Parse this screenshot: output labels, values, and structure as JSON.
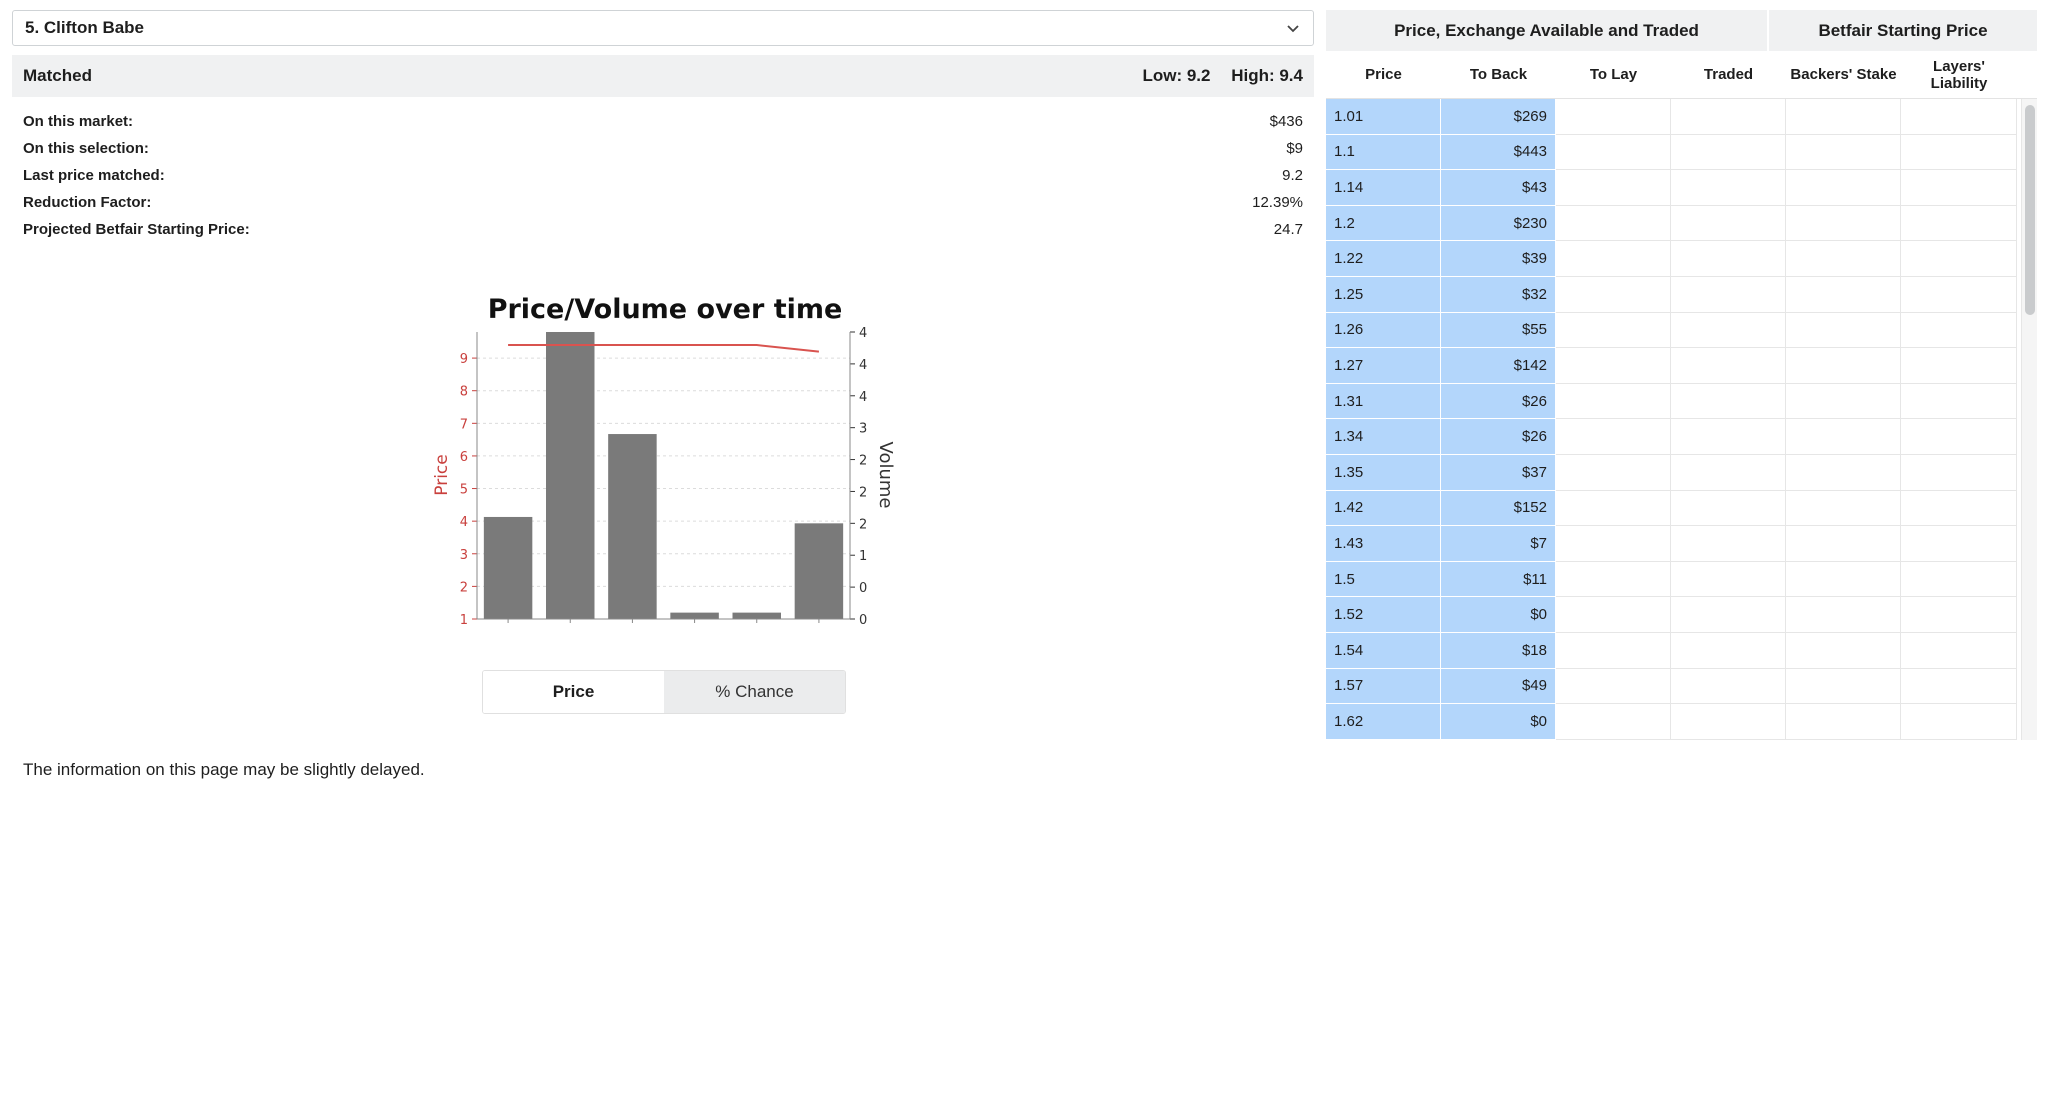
{
  "selection": {
    "label": "5. Clifton Babe",
    "icon": "chevron-down-icon"
  },
  "matched": {
    "title": "Matched",
    "low": "Low: 9.2",
    "high": "High: 9.4"
  },
  "stats": [
    {
      "label": "On this market:",
      "value": "$436"
    },
    {
      "label": "On this selection:",
      "value": "$9"
    },
    {
      "label": "Last price matched:",
      "value": "9.2"
    },
    {
      "label": "Reduction Factor:",
      "value": "12.39%"
    },
    {
      "label": "Projected Betfair Starting Price:",
      "value": "24.7"
    }
  ],
  "toggle": {
    "price": "Price",
    "chance": "% Chance"
  },
  "delay_note": "The information on this page may be slightly delayed.",
  "chart_data": {
    "type": "bar",
    "title": "Price/Volume over time",
    "ylabel": "Price",
    "y2label": "Volume",
    "ylim": [
      1,
      9.8
    ],
    "y2lim": [
      0,
      4.5
    ],
    "y_ticks": [
      "1",
      "2",
      "3",
      "4",
      "5",
      "6",
      "7",
      "8",
      "9"
    ],
    "y2_ticks": [
      "0",
      "0",
      "1",
      "2",
      "2",
      "2",
      "3",
      "4",
      "4",
      "4"
    ],
    "volume_values": [
      1.6,
      4.5,
      2.9,
      0.1,
      0.1,
      1.5
    ],
    "price_line": [
      9.4,
      9.4,
      9.4,
      9.4,
      9.4,
      9.2
    ],
    "colors": {
      "bars": "#7a7a7a",
      "price_line": "#d9534f",
      "price_axis": "#c9403d"
    },
    "grid": true
  },
  "ladder": {
    "group_headers": [
      "Price, Exchange Available and Traded",
      "Betfair Starting Price"
    ],
    "columns": [
      "Price",
      "To Back",
      "To Lay",
      "Traded",
      "Backers' Stake",
      "Layers' Liability"
    ],
    "rows": [
      {
        "price": "1.01",
        "back": "$269"
      },
      {
        "price": "1.1",
        "back": "$443"
      },
      {
        "price": "1.14",
        "back": "$43"
      },
      {
        "price": "1.2",
        "back": "$230"
      },
      {
        "price": "1.22",
        "back": "$39"
      },
      {
        "price": "1.25",
        "back": "$32"
      },
      {
        "price": "1.26",
        "back": "$55"
      },
      {
        "price": "1.27",
        "back": "$142"
      },
      {
        "price": "1.31",
        "back": "$26"
      },
      {
        "price": "1.34",
        "back": "$26"
      },
      {
        "price": "1.35",
        "back": "$37"
      },
      {
        "price": "1.42",
        "back": "$152"
      },
      {
        "price": "1.43",
        "back": "$7"
      },
      {
        "price": "1.5",
        "back": "$11"
      },
      {
        "price": "1.52",
        "back": "$0"
      },
      {
        "price": "1.54",
        "back": "$18"
      },
      {
        "price": "1.57",
        "back": "$49"
      },
      {
        "price": "1.62",
        "back": "$0"
      }
    ],
    "colors": {
      "back_cell": "#b3d6fb"
    }
  }
}
